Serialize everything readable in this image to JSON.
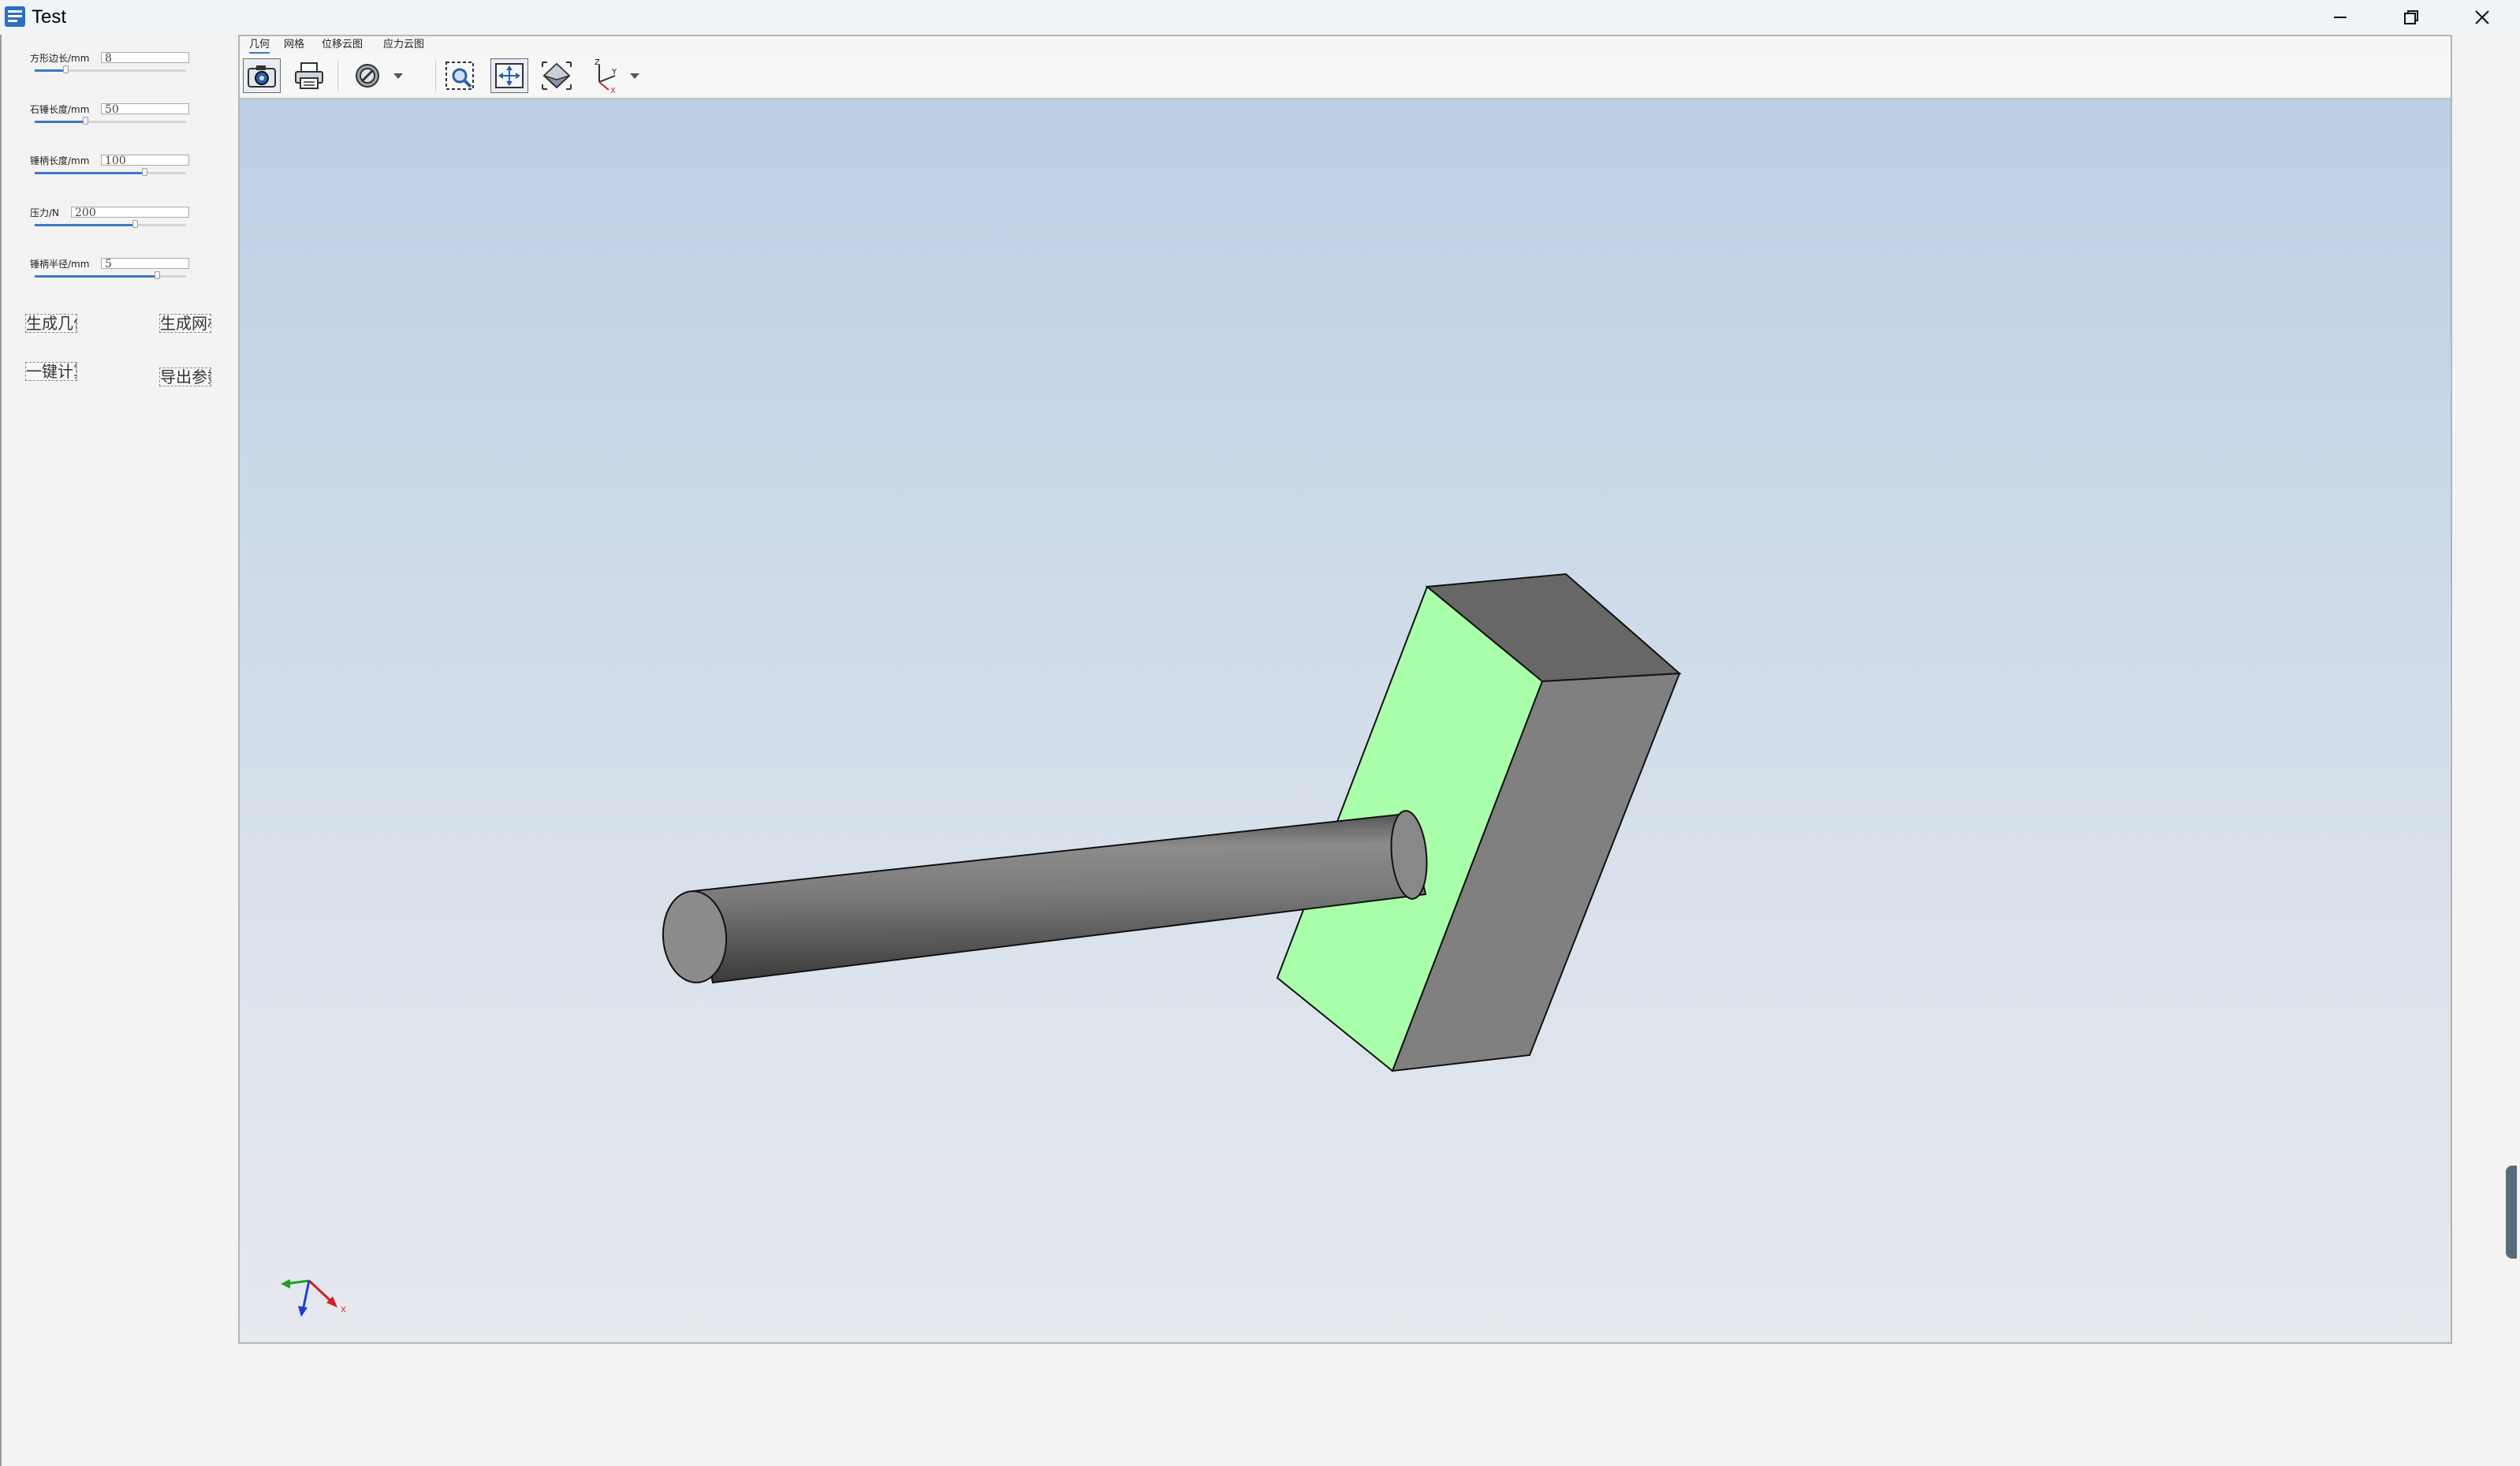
{
  "window": {
    "title": "Test",
    "controls": {
      "minimize": "minimize",
      "restore": "restore",
      "close": "close"
    }
  },
  "params": [
    {
      "label": "方形边长/mm",
      "value": "8",
      "slider_pct": 0.2
    },
    {
      "label": "石锤长度/mm",
      "value": "50",
      "slider_pct": 0.33
    },
    {
      "label": "锤柄长度/mm",
      "value": "100",
      "slider_pct": 0.72
    },
    {
      "label": "压力/N",
      "value": "200",
      "slider_pct": 0.66
    },
    {
      "label": "锤柄半径/mm",
      "value": "5",
      "slider_pct": 0.8
    }
  ],
  "buttons": {
    "generate_geometry": "生成几何",
    "generate_mesh": "生成网格",
    "one_click_compute": "一键计算",
    "export_params": "导出参数"
  },
  "tabs": [
    "几何",
    "网格",
    "位移云图",
    "应力云图"
  ],
  "active_tab": 0,
  "toolbar": {
    "icons": [
      "camera-icon",
      "print-icon",
      "display-mode-icon",
      "dropdown-arrow-icon",
      "zoom-window-icon",
      "fit-all-icon",
      "iso-view-icon",
      "axis-view-icon",
      "dropdown-arrow-icon"
    ]
  },
  "viewport": {
    "background_top": "#bccfe4",
    "background_bottom": "#e6e9ee",
    "model_face_highlight": "#aaffaa",
    "model_gray": "#808080",
    "axes": {
      "x": "X",
      "y": "Y",
      "z": "Z"
    }
  }
}
